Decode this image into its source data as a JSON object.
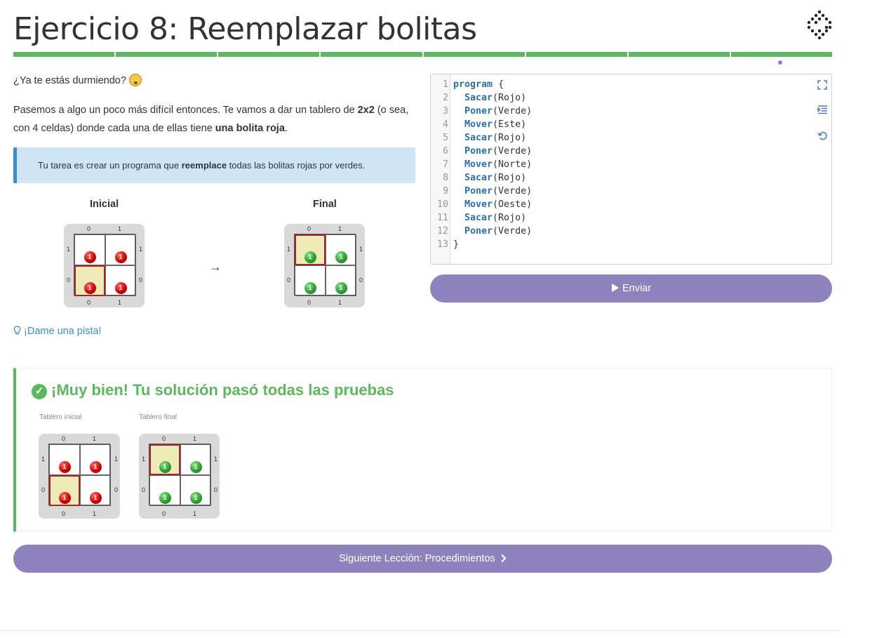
{
  "page": {
    "title": "Ejercicio 8: Reemplazar bolitas"
  },
  "progress": {
    "segments": 8,
    "color": "#5cb85c"
  },
  "description": {
    "intro": "¿Ya te estás durmiendo?",
    "para_1": "Pasemos a algo un poco más difícil entonces. Te vamos a dar un tablero de ",
    "para_bold_1": "2x2",
    "para_2": " (o sea, con 4 celdas) donde cada una de ellas tiene ",
    "para_bold_2": "una bolita roja",
    "para_3": "."
  },
  "callout": {
    "before": "Tu tarea es crear un programa que ",
    "bold": "reemplace",
    "after": " todas las bolitas rojas por verdes."
  },
  "boards": {
    "initial_label": "Inicial",
    "final_label": "Final",
    "arrow": "→",
    "axis": {
      "x": [
        "0",
        "1"
      ],
      "y": [
        "1",
        "0"
      ]
    },
    "ball_count": "1"
  },
  "hint": {
    "label": "¡Dame una pista!"
  },
  "editor": {
    "lines": [
      [
        "program",
        " {"
      ],
      [
        "  Sacar",
        "(Rojo)"
      ],
      [
        "  Poner",
        "(Verde)"
      ],
      [
        "  Mover",
        "(Este)"
      ],
      [
        "  Sacar",
        "(Rojo)"
      ],
      [
        "  Poner",
        "(Verde)"
      ],
      [
        "  Mover",
        "(Norte)"
      ],
      [
        "  Sacar",
        "(Rojo)"
      ],
      [
        "  Poner",
        "(Verde)"
      ],
      [
        "  Mover",
        "(Oeste)"
      ],
      [
        "  Sacar",
        "(Rojo)"
      ],
      [
        "  Poner",
        "(Verde)"
      ],
      [
        "}",
        ""
      ]
    ],
    "line_numbers": [
      "1",
      "2",
      "3",
      "4",
      "5",
      "6",
      "7",
      "8",
      "9",
      "10",
      "11",
      "12",
      "13"
    ]
  },
  "actions": {
    "send_label": "Enviar",
    "next_label": "Siguiente Lección: Procedimientos"
  },
  "result": {
    "title": "¡Muy bien! Tu solución pasó todas las pruebas",
    "initial_board_label": "Tablero inicial",
    "final_board_label": "Tablero final"
  },
  "colors": {
    "accent": "#8e82bf",
    "success": "#5cb85c",
    "info_bg": "#cfe4f5",
    "info_border": "#3a8dd1"
  }
}
